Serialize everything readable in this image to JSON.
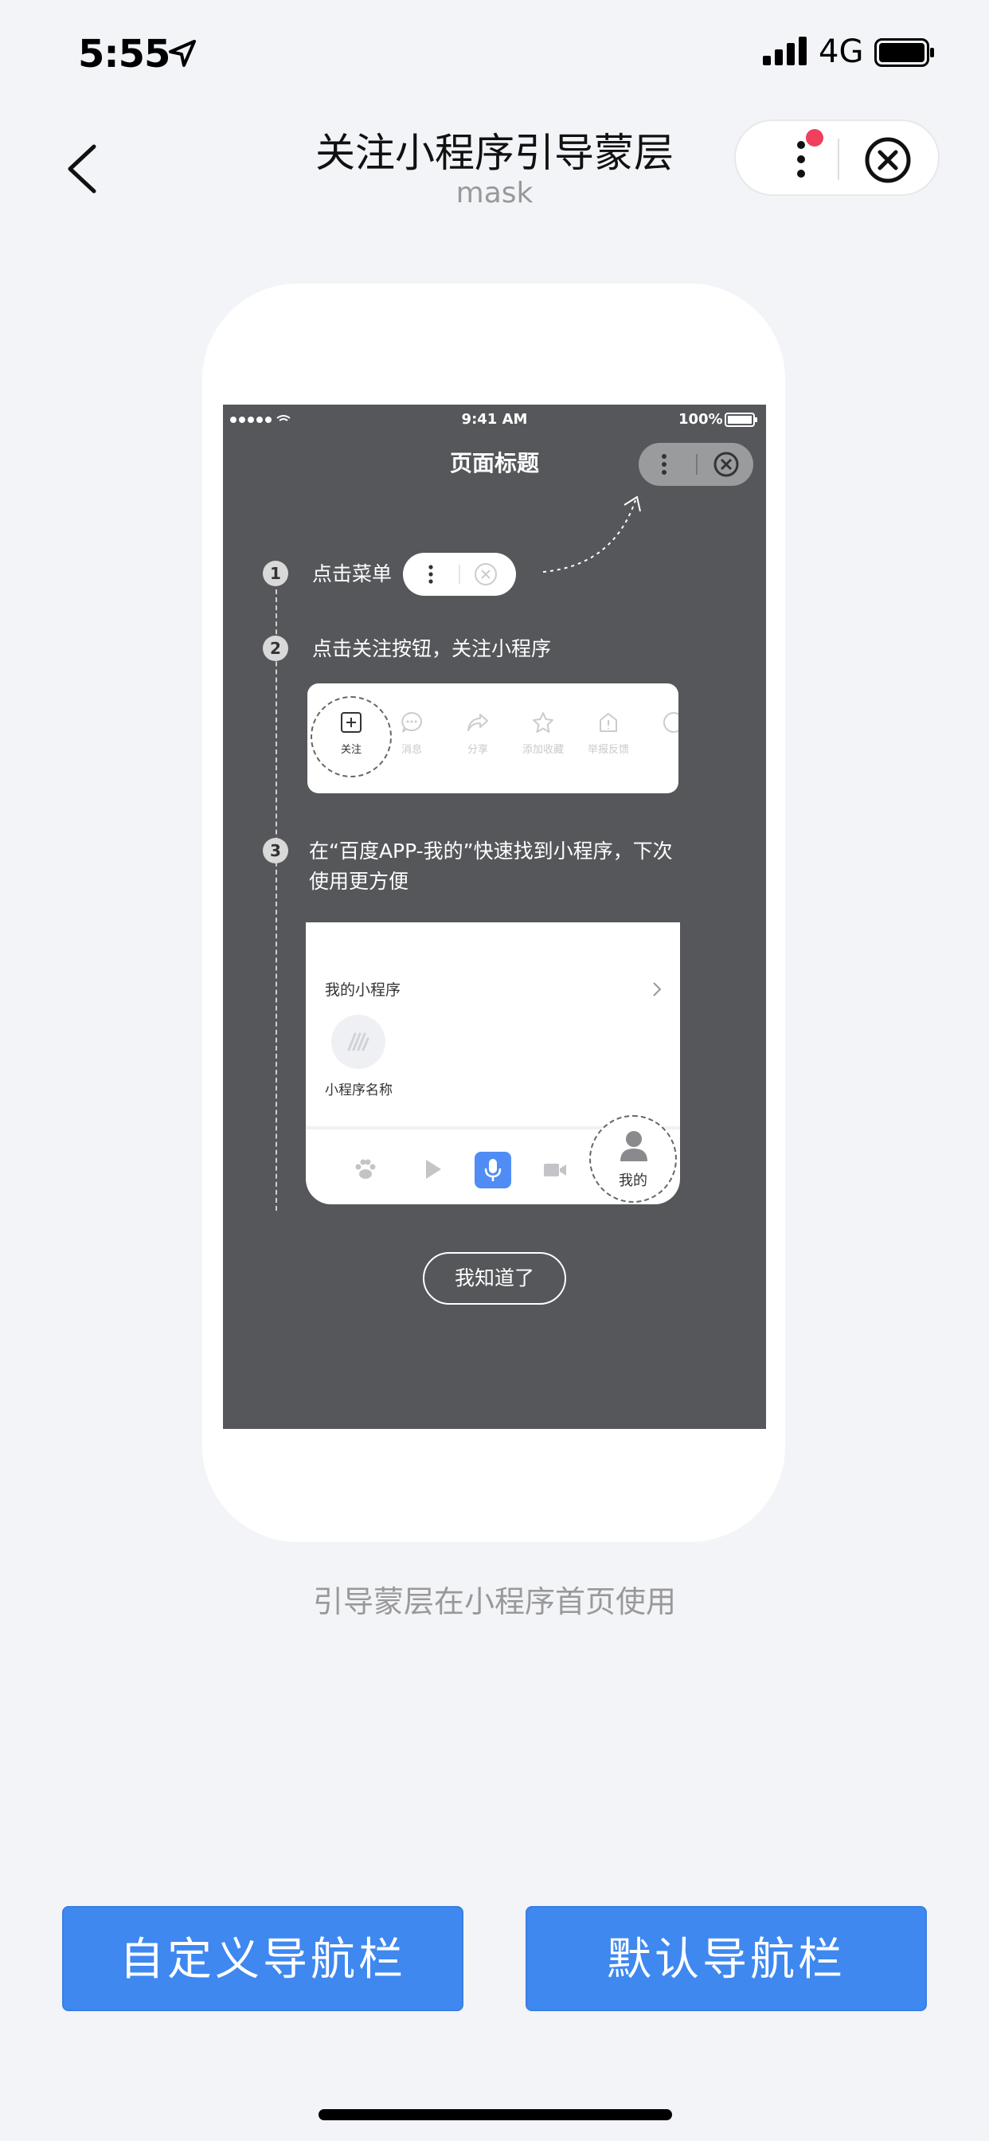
{
  "status_bar": {
    "time": "5:55",
    "network": "4G"
  },
  "nav": {
    "title": "关注小程序引导蒙层",
    "subtitle": "mask"
  },
  "illustration": {
    "status_time": "9:41 AM",
    "status_battery": "100%",
    "page_title": "页面标题",
    "steps": [
      {
        "number": "1",
        "text": "点击菜单"
      },
      {
        "number": "2",
        "text": "点击关注按钮，关注小程序"
      },
      {
        "number": "3",
        "line1": "在“百度APP-我的”快速找到小程序，下次",
        "line2": "使用更方便"
      }
    ],
    "menu_items": [
      "关注",
      "消息",
      "分享",
      "添加收藏",
      "举报反馈"
    ],
    "my_section_title": "我的小程序",
    "program_name": "小程序名称",
    "tab_mine": "我的",
    "got_it": "我知道了"
  },
  "caption": "引导蒙层在小程序首页使用",
  "buttons": {
    "custom": "自定义导航栏",
    "default": "默认导航栏"
  },
  "colors": {
    "accent": "#3e88f0",
    "badge": "#f0405e",
    "mask": "#55575a"
  }
}
